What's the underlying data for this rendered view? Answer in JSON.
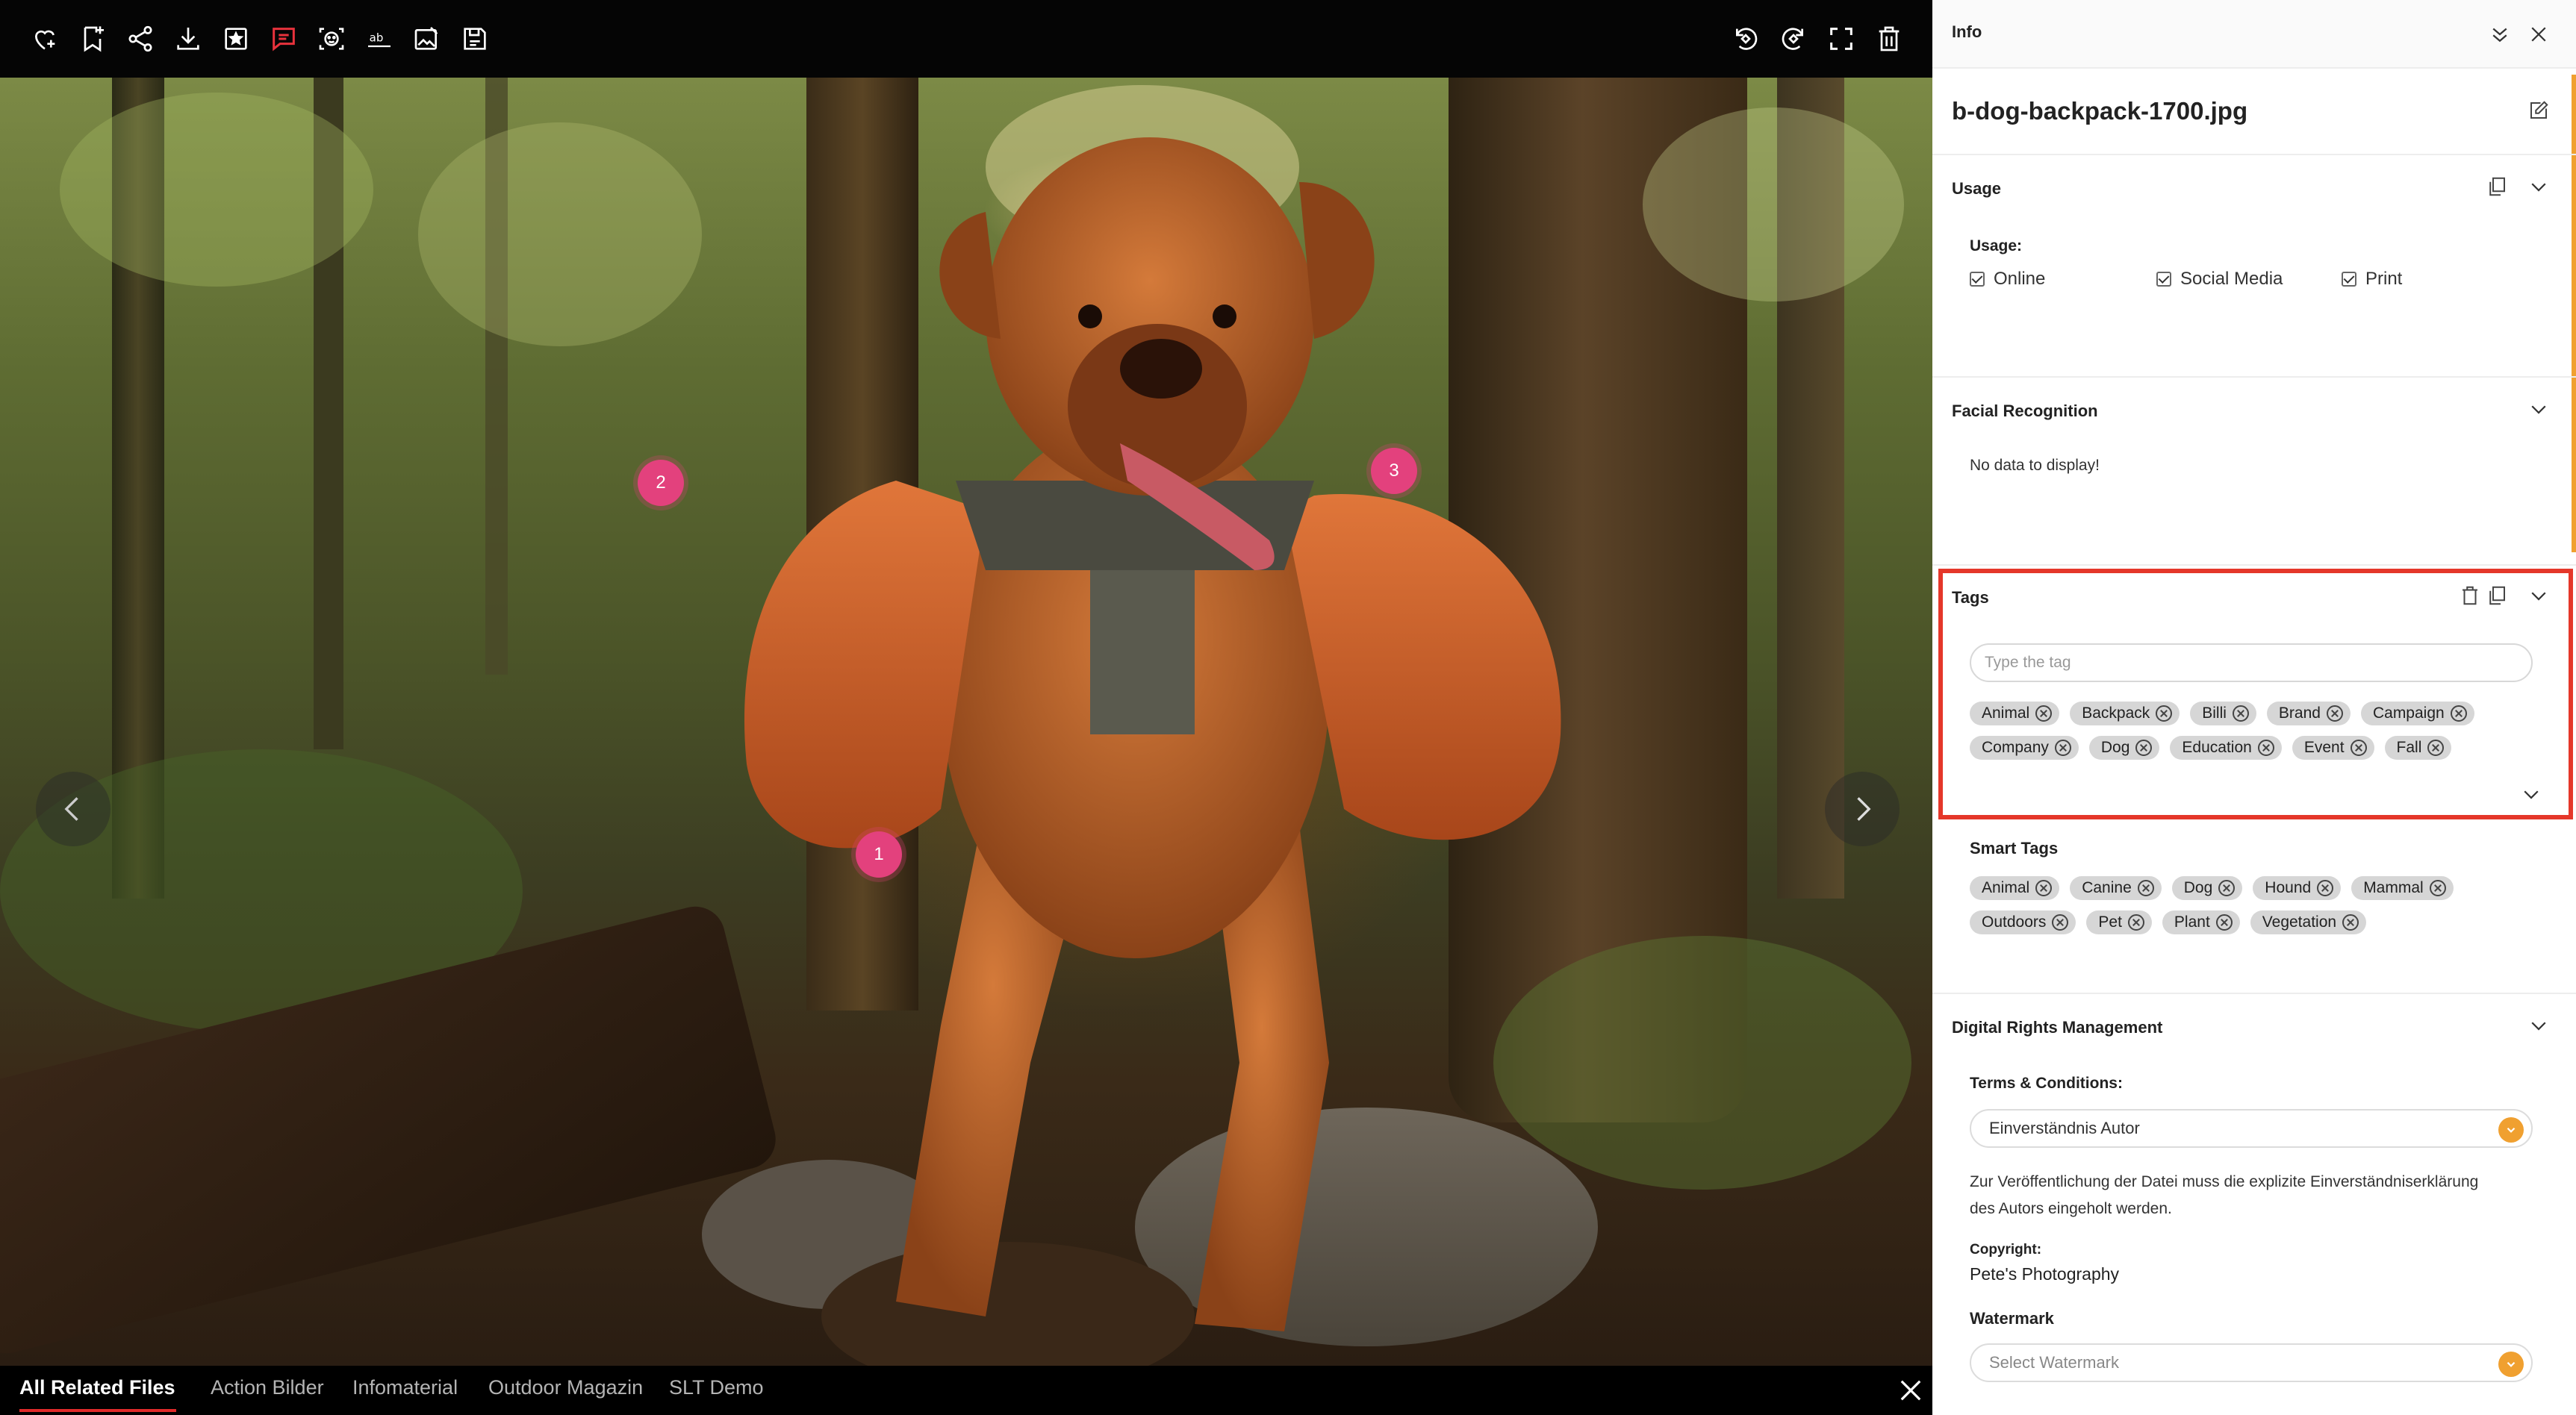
{
  "viewer": {
    "hotspots": [
      "1",
      "2",
      "3"
    ],
    "tabs": [
      "All Related Files",
      "Action Bilder",
      "Infomaterial",
      "Outdoor Magazin",
      "SLT Demo"
    ]
  },
  "toolbar": {
    "left_icons": [
      "heart-plus-icon",
      "bookmark-plus-icon",
      "share-icon",
      "download-icon",
      "star-box-icon",
      "comment-icon",
      "face-scan-icon",
      "text-recognition-icon",
      "image-edit-icon",
      "save-version-icon"
    ],
    "right_icons": [
      "rotate-left-icon",
      "rotate-right-icon",
      "fullscreen-icon",
      "trash-icon"
    ]
  },
  "colors": {
    "accent": "#f0a030",
    "hotspot": "#e3417d",
    "highlight": "#e5372a",
    "active_tab": "#e02a2a"
  },
  "panel": {
    "title": "Info",
    "filename": "b-dog-backpack-1700.jpg",
    "usage": {
      "title": "Usage",
      "label": "Usage:",
      "options": [
        "Online",
        "Social Media",
        "Print"
      ]
    },
    "facial": {
      "title": "Facial Recognition",
      "empty": "No data to display!"
    },
    "tags": {
      "title": "Tags",
      "placeholder": "Type the tag",
      "row1": [
        "Animal",
        "Backpack",
        "Billi",
        "Brand",
        "Campaign"
      ],
      "row2": [
        "Company",
        "Dog",
        "Education",
        "Event",
        "Fall"
      ]
    },
    "smart_tags": {
      "title": "Smart Tags",
      "row1": [
        "Animal",
        "Canine",
        "Dog",
        "Hound",
        "Mammal"
      ],
      "row2": [
        "Outdoors",
        "Pet",
        "Plant",
        "Vegetation"
      ]
    },
    "drm": {
      "title": "Digital Rights Management",
      "terms_label": "Terms & Conditions:",
      "terms_value": "Einverständnis Autor",
      "description_line1": "Zur Veröffentlichung der Datei muss die explizite Einverständniserklärung",
      "description_line2": "des Autors eingeholt werden.",
      "copyright_label": "Copyright:",
      "copyright_value": "Pete's Photography",
      "watermark_label": "Watermark",
      "watermark_placeholder": "Select Watermark"
    }
  }
}
